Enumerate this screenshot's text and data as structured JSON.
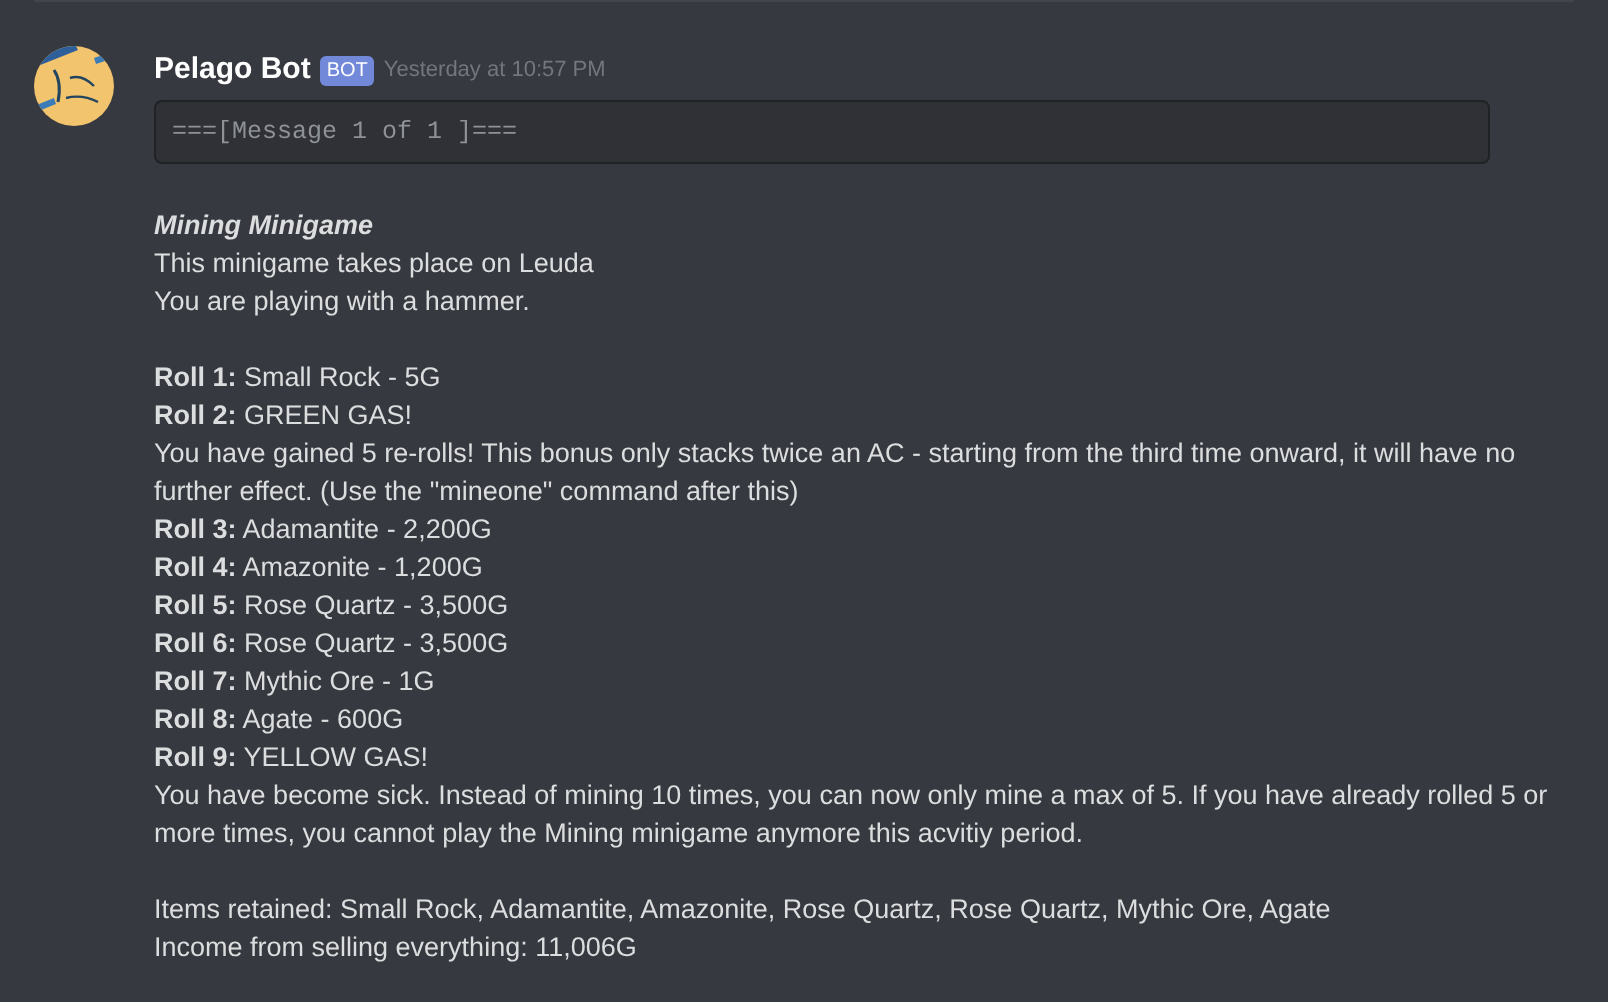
{
  "message": {
    "author": "Pelago Bot",
    "badge": "BOT",
    "timestamp": "Yesterday at 10:57 PM",
    "code_block": "===[Message 1 of 1 ]===",
    "lines": [
      {
        "kind": "title",
        "text": "Mining Minigame"
      },
      {
        "kind": "text",
        "text": "This minigame takes place on Leuda"
      },
      {
        "kind": "text",
        "text": "You are playing with a hammer."
      },
      {
        "kind": "blank"
      },
      {
        "kind": "text",
        "text": "**Roll 1:** Small Rock - 5G"
      },
      {
        "kind": "text",
        "text": "**Roll 2:** GREEN GAS!"
      },
      {
        "kind": "text",
        "text": "You have gained 5 re-rolls! This bonus only stacks twice an AC - starting from the third time onward, it will have no further effect. (Use the \"mineone\" command after this)"
      },
      {
        "kind": "text",
        "text": "**Roll 3:** Adamantite - 2,200G"
      },
      {
        "kind": "text",
        "text": "**Roll 4:** Amazonite - 1,200G"
      },
      {
        "kind": "text",
        "text": "**Roll 5:** Rose Quartz - 3,500G"
      },
      {
        "kind": "text",
        "text": "**Roll 6:** Rose Quartz - 3,500G"
      },
      {
        "kind": "text",
        "text": "**Roll 7:** Mythic Ore - 1G"
      },
      {
        "kind": "text",
        "text": "**Roll 8:** Agate - 600G"
      },
      {
        "kind": "text",
        "text": "**Roll 9:** YELLOW GAS!"
      },
      {
        "kind": "text",
        "text": "You have become sick. Instead of mining 10 times, you can now only mine a max of 5. If you have already rolled 5 or more times, you cannot play the Mining minigame anymore this acvitiy period."
      },
      {
        "kind": "blank"
      },
      {
        "kind": "text",
        "text": "Items retained: Small Rock, Adamantite, Amazonite, Rose Quartz, Rose Quartz, Mythic Ore, Agate"
      },
      {
        "kind": "text",
        "text": "Income from selling everything: 11,006G"
      }
    ]
  }
}
